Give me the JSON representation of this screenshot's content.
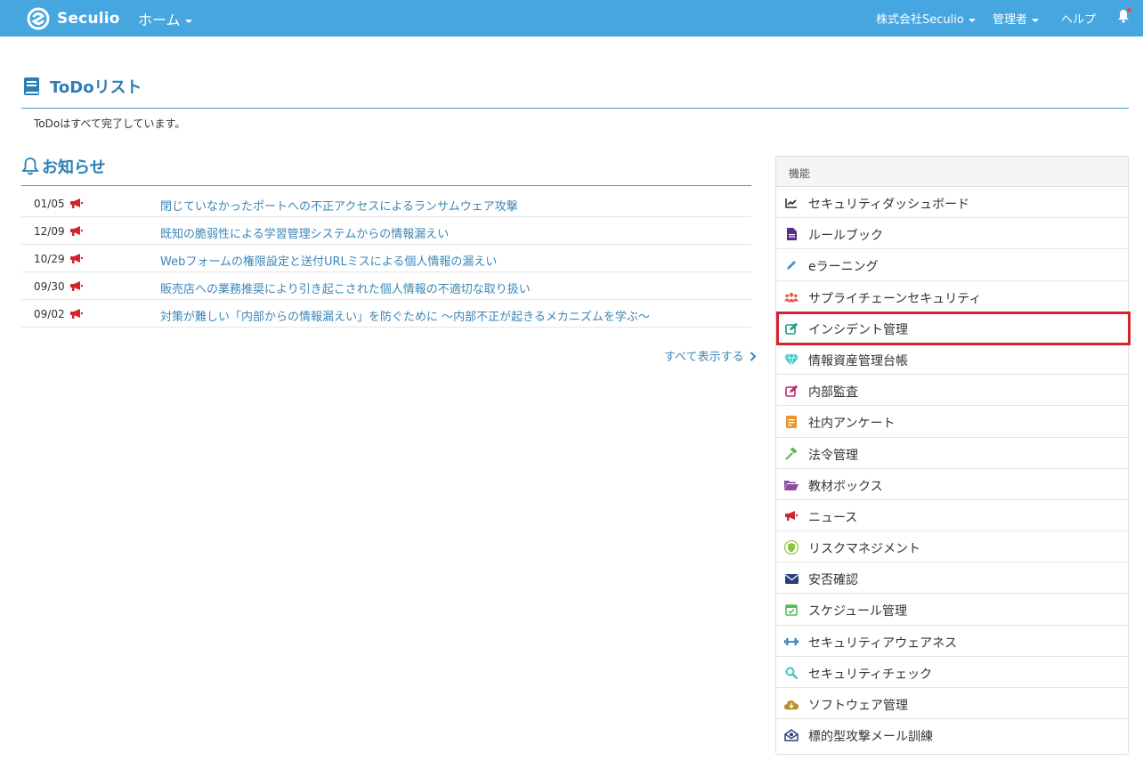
{
  "navbar": {
    "logo_text": "Seculio",
    "home_label": "ホーム",
    "company_label": "株式会社Seculio",
    "admin_label": "管理者",
    "help_label": "ヘルプ"
  },
  "todo": {
    "title": "ToDoリスト",
    "message": "ToDoはすべて完了しています。"
  },
  "news": {
    "title": "お知らせ",
    "items": [
      {
        "date": "01/05",
        "text": "閉じていなかったポートへの不正アクセスによるランサムウェア攻撃"
      },
      {
        "date": "12/09",
        "text": "既知の脆弱性による学習管理システムからの情報漏えい"
      },
      {
        "date": "10/29",
        "text": "Webフォームの権限設定と送付URLミスによる個人情報の漏えい"
      },
      {
        "date": "09/30",
        "text": "販売店への業務推奨により引き起こされた個人情報の不適切な取り扱い"
      },
      {
        "date": "09/02",
        "text": "対策が難しい「内部からの情報漏えい」を防ぐために ～内部不正が起きるメカニズムを学ぶ～"
      }
    ],
    "show_all_label": "すべて表示する"
  },
  "functions": {
    "header": "機能",
    "items": [
      {
        "label": "セキュリティダッシュボード",
        "icon": "chart-line-icon",
        "color": "#333333"
      },
      {
        "label": "ルールブック",
        "icon": "document-icon",
        "color": "#5b2c8e"
      },
      {
        "label": "eラーニング",
        "icon": "pencil-icon",
        "color": "#4a90d9"
      },
      {
        "label": "サプライチェーンセキュリティ",
        "icon": "users-icon",
        "color": "#e05a4f"
      },
      {
        "label": "インシデント管理",
        "icon": "edit-icon",
        "color": "#1a9a8a"
      },
      {
        "label": "情報資産管理台帳",
        "icon": "diamond-icon",
        "color": "#3ec7c7"
      },
      {
        "label": "内部監査",
        "icon": "edit-icon",
        "color": "#c2256b"
      },
      {
        "label": "社内アンケート",
        "icon": "survey-icon",
        "color": "#e8962b"
      },
      {
        "label": "法令管理",
        "icon": "gavel-icon",
        "color": "#5cb85c"
      },
      {
        "label": "教材ボックス",
        "icon": "folder-icon",
        "color": "#8a4fa0"
      },
      {
        "label": "ニュース",
        "icon": "megaphone-icon",
        "color": "#d3232f"
      },
      {
        "label": "リスクマネジメント",
        "icon": "shield-icon",
        "color": "#8cc63f"
      },
      {
        "label": "安否確認",
        "icon": "envelope-icon",
        "color": "#2b3f7a"
      },
      {
        "label": "スケジュール管理",
        "icon": "calendar-check-icon",
        "color": "#5cb85c"
      },
      {
        "label": "セキュリティアウェアネス",
        "icon": "dumbbell-icon",
        "color": "#2a7fb6"
      },
      {
        "label": "セキュリティチェック",
        "icon": "search-icon",
        "color": "#3ec7c7"
      },
      {
        "label": "ソフトウェア管理",
        "icon": "cloud-download-icon",
        "color": "#b8902a"
      },
      {
        "label": "標的型攻撃メール訓練",
        "icon": "mail-bug-icon",
        "color": "#2b3f7a"
      }
    ],
    "highlighted": "インシデント管理"
  },
  "colors": {
    "navbar": "#45a6e0",
    "accent": "#2a7fb6",
    "link": "#3b87b8",
    "highlight_border": "#d3232f"
  }
}
